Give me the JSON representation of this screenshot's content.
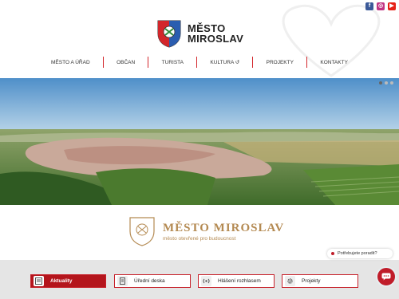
{
  "social": {
    "facebook": "f",
    "instagram": "◎",
    "youtube": "▶"
  },
  "logo": {
    "line1": "MĚSTO",
    "line2": "MIROSLAV"
  },
  "nav": {
    "items": [
      {
        "label": "MĚSTO A ÚŘAD"
      },
      {
        "label": "OBČAN"
      },
      {
        "label": "TURISTA"
      },
      {
        "label": "KULTURA ↺"
      },
      {
        "label": "PROJEKTY"
      },
      {
        "label": "KONTAKTY"
      }
    ]
  },
  "brand": {
    "title": "MĚSTO MIROSLAV",
    "tagline": "město otevřené pro budoucnost"
  },
  "advice": {
    "label": "Potřebujete poradit?"
  },
  "quick_links": [
    {
      "label": "Aktuality",
      "icon": "news-icon"
    },
    {
      "label": "Úřední deska",
      "icon": "document-icon"
    },
    {
      "label": "Hlášení rozhlasem",
      "icon": "broadcast-icon"
    },
    {
      "label": "Projekty",
      "icon": "gear-icon"
    }
  ],
  "colors": {
    "accent": "#c01d2a",
    "gold": "#b48a52",
    "bar": "#e5e5e5"
  }
}
